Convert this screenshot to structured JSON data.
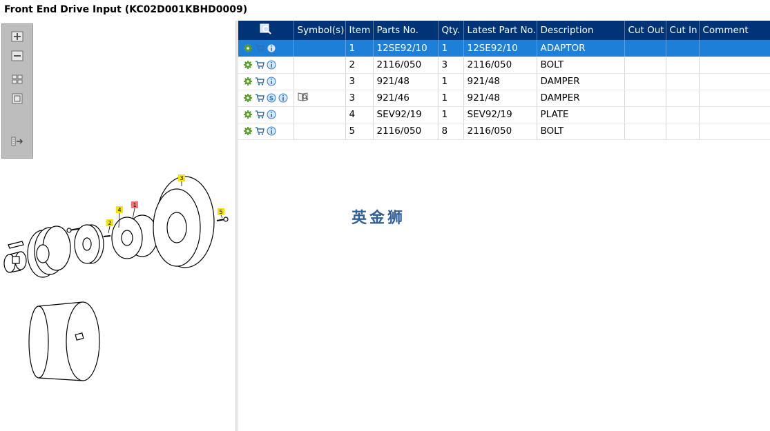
{
  "window": {
    "title": "Front End Drive Input (KC02D001KBHD0009)"
  },
  "toolbar": {
    "buttons": [
      {
        "name": "zoom-in-icon"
      },
      {
        "name": "zoom-out-icon"
      },
      {
        "name": "fit-icon"
      },
      {
        "name": "actual-size-icon"
      },
      {
        "name": "export-icon"
      }
    ]
  },
  "drawing": {
    "callouts": [
      "1",
      "2",
      "3",
      "4",
      "5"
    ]
  },
  "table": {
    "columns": {
      "search": "",
      "symbols": "Symbol(s)",
      "item": "Item",
      "parts_no": "Parts No.",
      "qty": "Qty.",
      "latest": "Latest Part No.",
      "description": "Description",
      "cut_out": "Cut Out",
      "cut_in": "Cut In",
      "comment": "Comment"
    },
    "rows": [
      {
        "item": "1",
        "parts_no": "12SE92/10",
        "qty": "1",
        "latest": "12SE92/10",
        "description": "ADAPTOR",
        "selected": true,
        "has_s": false,
        "has_symbol": false
      },
      {
        "item": "2",
        "parts_no": "2116/050",
        "qty": "3",
        "latest": "2116/050",
        "description": "BOLT",
        "selected": false,
        "has_s": false,
        "has_symbol": false
      },
      {
        "item": "3",
        "parts_no": "921/48",
        "qty": "1",
        "latest": "921/48",
        "description": "DAMPER",
        "selected": false,
        "has_s": false,
        "has_symbol": false
      },
      {
        "item": "3",
        "parts_no": "921/46",
        "qty": "1",
        "latest": "921/48",
        "description": "DAMPER",
        "selected": false,
        "has_s": true,
        "has_symbol": true
      },
      {
        "item": "4",
        "parts_no": "SEV92/19",
        "qty": "1",
        "latest": "SEV92/19",
        "description": "PLATE",
        "selected": false,
        "has_s": false,
        "has_symbol": false
      },
      {
        "item": "5",
        "parts_no": "2116/050",
        "qty": "8",
        "latest": "2116/050",
        "description": "BOLT",
        "selected": false,
        "has_s": false,
        "has_symbol": false
      }
    ],
    "s_badge": "S"
  },
  "watermark": {
    "text": "英金狮"
  },
  "colors": {
    "header_bg": "#003476",
    "selected_row": "#1e7fd8",
    "callout_yellow": "#f5e400",
    "callout_red": "#f07878",
    "gear_green": "#5aa02c",
    "info_blue": "#2a7bd2"
  }
}
